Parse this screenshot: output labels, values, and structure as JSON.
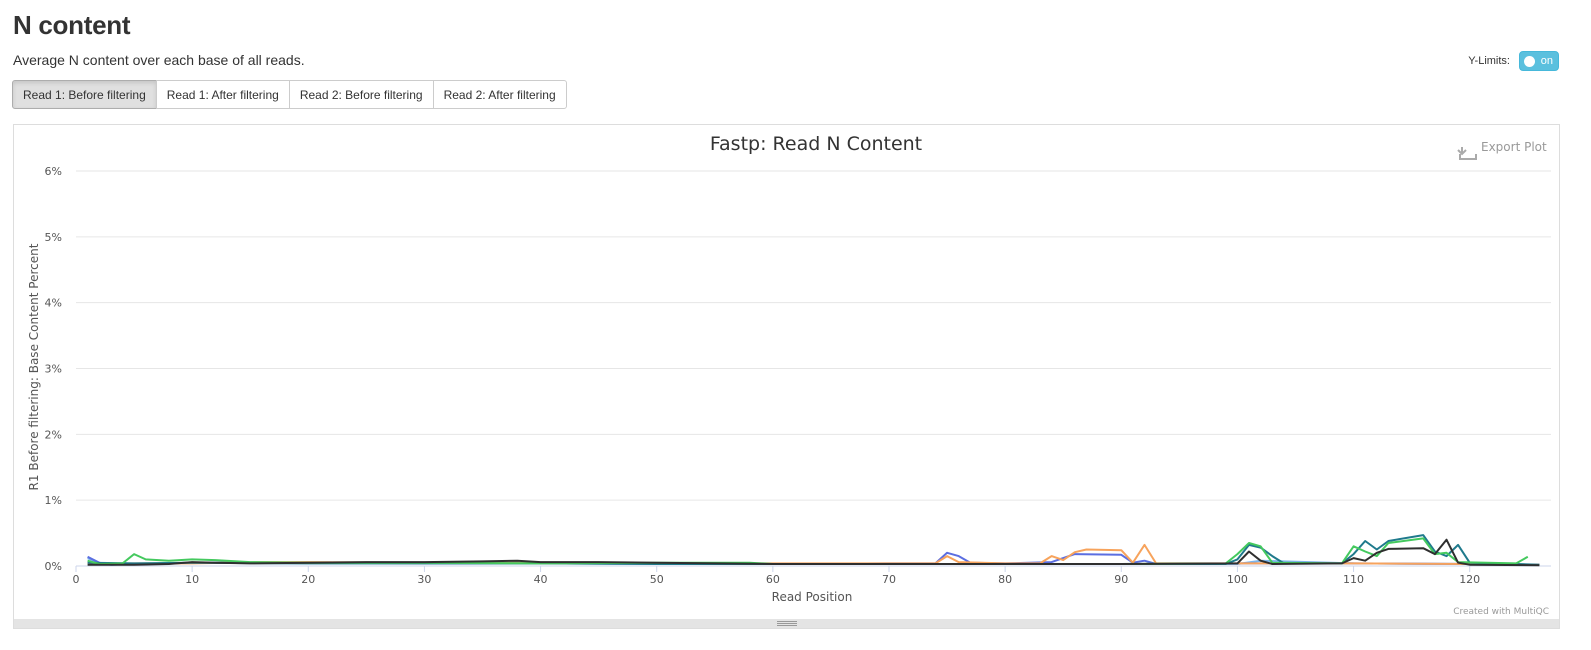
{
  "page": {
    "title": "N content",
    "description": "Average N content over each base of all reads.",
    "ylimits_label": "Y-Limits:",
    "ylimits_state": "on"
  },
  "tabs": [
    {
      "label": "Read 1: Before filtering",
      "active": true
    },
    {
      "label": "Read 1: After filtering",
      "active": false
    },
    {
      "label": "Read 2: Before filtering",
      "active": false
    },
    {
      "label": "Read 2: After filtering",
      "active": false
    }
  ],
  "plot": {
    "export_label": "Export Plot",
    "credit": "Created with MultiQC"
  },
  "chart_data": {
    "type": "line",
    "title": "Fastp: Read N Content",
    "xlabel": "Read Position",
    "ylabel": "R1 Before filtering: Base Content Percent",
    "xlim": [
      0,
      127
    ],
    "ylim": [
      0,
      6
    ],
    "xticks": [
      "0",
      "10",
      "20",
      "30",
      "40",
      "50",
      "60",
      "70",
      "80",
      "90",
      "100",
      "110",
      "120"
    ],
    "yticks": [
      "0%",
      "1%",
      "2%",
      "3%",
      "4%",
      "5%",
      "6%"
    ],
    "grid": true,
    "series": [
      {
        "color": "#7cb5ec",
        "points": [
          [
            1,
            0.12
          ],
          [
            2,
            0.04
          ],
          [
            3,
            0.02
          ],
          [
            5,
            0.03
          ],
          [
            10,
            0.05
          ],
          [
            20,
            0.04
          ],
          [
            30,
            0.04
          ],
          [
            40,
            0.04
          ],
          [
            50,
            0.03
          ],
          [
            60,
            0.03
          ],
          [
            70,
            0.03
          ],
          [
            80,
            0.03
          ],
          [
            90,
            0.03
          ],
          [
            100,
            0.03
          ],
          [
            102,
            0.08
          ],
          [
            110,
            0.04
          ],
          [
            120,
            0.03
          ],
          [
            126,
            0.02
          ]
        ]
      },
      {
        "color": "#5b6ee1",
        "points": [
          [
            1,
            0.14
          ],
          [
            2,
            0.05
          ],
          [
            3,
            0.02
          ],
          [
            5,
            0.03
          ],
          [
            10,
            0.05
          ],
          [
            20,
            0.05
          ],
          [
            30,
            0.04
          ],
          [
            40,
            0.04
          ],
          [
            50,
            0.04
          ],
          [
            60,
            0.03
          ],
          [
            70,
            0.04
          ],
          [
            74,
            0.04
          ],
          [
            75,
            0.2
          ],
          [
            76,
            0.15
          ],
          [
            77,
            0.05
          ],
          [
            80,
            0.04
          ],
          [
            84,
            0.06
          ],
          [
            86,
            0.18
          ],
          [
            90,
            0.17
          ],
          [
            91,
            0.05
          ],
          [
            92,
            0.08
          ],
          [
            93,
            0.03
          ],
          [
            100,
            0.04
          ],
          [
            110,
            0.04
          ],
          [
            120,
            0.03
          ],
          [
            126,
            0.02
          ]
        ]
      },
      {
        "color": "#f7a35c",
        "points": [
          [
            1,
            0.05
          ],
          [
            2,
            0.03
          ],
          [
            5,
            0.04
          ],
          [
            10,
            0.04
          ],
          [
            16,
            0.06
          ],
          [
            20,
            0.06
          ],
          [
            30,
            0.05
          ],
          [
            40,
            0.05
          ],
          [
            50,
            0.04
          ],
          [
            60,
            0.04
          ],
          [
            70,
            0.04
          ],
          [
            74,
            0.04
          ],
          [
            75,
            0.15
          ],
          [
            76,
            0.06
          ],
          [
            80,
            0.04
          ],
          [
            83,
            0.04
          ],
          [
            84,
            0.15
          ],
          [
            85,
            0.09
          ],
          [
            86,
            0.21
          ],
          [
            87,
            0.25
          ],
          [
            90,
            0.24
          ],
          [
            91,
            0.05
          ],
          [
            92,
            0.32
          ],
          [
            93,
            0.04
          ],
          [
            100,
            0.04
          ],
          [
            110,
            0.04
          ],
          [
            120,
            0.03
          ],
          [
            126,
            0.02
          ]
        ]
      },
      {
        "color": "#1f7a8c",
        "points": [
          [
            1,
            0.05
          ],
          [
            5,
            0.04
          ],
          [
            10,
            0.05
          ],
          [
            20,
            0.04
          ],
          [
            30,
            0.04
          ],
          [
            40,
            0.04
          ],
          [
            50,
            0.03
          ],
          [
            60,
            0.03
          ],
          [
            70,
            0.03
          ],
          [
            80,
            0.03
          ],
          [
            90,
            0.03
          ],
          [
            99,
            0.03
          ],
          [
            100,
            0.1
          ],
          [
            101,
            0.32
          ],
          [
            102,
            0.28
          ],
          [
            103,
            0.15
          ],
          [
            104,
            0.04
          ],
          [
            109,
            0.04
          ],
          [
            110,
            0.18
          ],
          [
            111,
            0.38
          ],
          [
            112,
            0.25
          ],
          [
            113,
            0.38
          ],
          [
            116,
            0.47
          ],
          [
            117,
            0.22
          ],
          [
            118,
            0.15
          ],
          [
            119,
            0.32
          ],
          [
            120,
            0.05
          ],
          [
            126,
            0.02
          ]
        ]
      },
      {
        "color": "#44c95e",
        "points": [
          [
            1,
            0.08
          ],
          [
            2,
            0.03
          ],
          [
            4,
            0.04
          ],
          [
            5,
            0.18
          ],
          [
            6,
            0.1
          ],
          [
            8,
            0.08
          ],
          [
            10,
            0.1
          ],
          [
            12,
            0.09
          ],
          [
            15,
            0.06
          ],
          [
            20,
            0.05
          ],
          [
            30,
            0.05
          ],
          [
            40,
            0.04
          ],
          [
            50,
            0.05
          ],
          [
            58,
            0.05
          ],
          [
            60,
            0.03
          ],
          [
            70,
            0.03
          ],
          [
            80,
            0.03
          ],
          [
            90,
            0.03
          ],
          [
            99,
            0.04
          ],
          [
            100,
            0.18
          ],
          [
            101,
            0.35
          ],
          [
            102,
            0.3
          ],
          [
            103,
            0.05
          ],
          [
            109,
            0.04
          ],
          [
            110,
            0.3
          ],
          [
            111,
            0.22
          ],
          [
            112,
            0.15
          ],
          [
            113,
            0.35
          ],
          [
            116,
            0.42
          ],
          [
            117,
            0.18
          ],
          [
            118,
            0.2
          ],
          [
            119,
            0.06
          ],
          [
            124,
            0.04
          ],
          [
            125,
            0.14
          ]
        ]
      },
      {
        "color": "#2f2f2f",
        "points": [
          [
            1,
            0.02
          ],
          [
            2,
            0.02
          ],
          [
            5,
            0.02
          ],
          [
            8,
            0.03
          ],
          [
            10,
            0.06
          ],
          [
            12,
            0.05
          ],
          [
            15,
            0.04
          ],
          [
            20,
            0.05
          ],
          [
            25,
            0.06
          ],
          [
            30,
            0.06
          ],
          [
            35,
            0.07
          ],
          [
            38,
            0.08
          ],
          [
            40,
            0.06
          ],
          [
            45,
            0.06
          ],
          [
            50,
            0.05
          ],
          [
            60,
            0.03
          ],
          [
            70,
            0.03
          ],
          [
            80,
            0.03
          ],
          [
            90,
            0.03
          ],
          [
            100,
            0.04
          ],
          [
            101,
            0.22
          ],
          [
            102,
            0.08
          ],
          [
            103,
            0.03
          ],
          [
            109,
            0.04
          ],
          [
            110,
            0.12
          ],
          [
            111,
            0.08
          ],
          [
            112,
            0.2
          ],
          [
            113,
            0.26
          ],
          [
            116,
            0.27
          ],
          [
            117,
            0.18
          ],
          [
            118,
            0.4
          ],
          [
            119,
            0.05
          ],
          [
            120,
            0.02
          ],
          [
            126,
            0.01
          ]
        ]
      }
    ]
  }
}
